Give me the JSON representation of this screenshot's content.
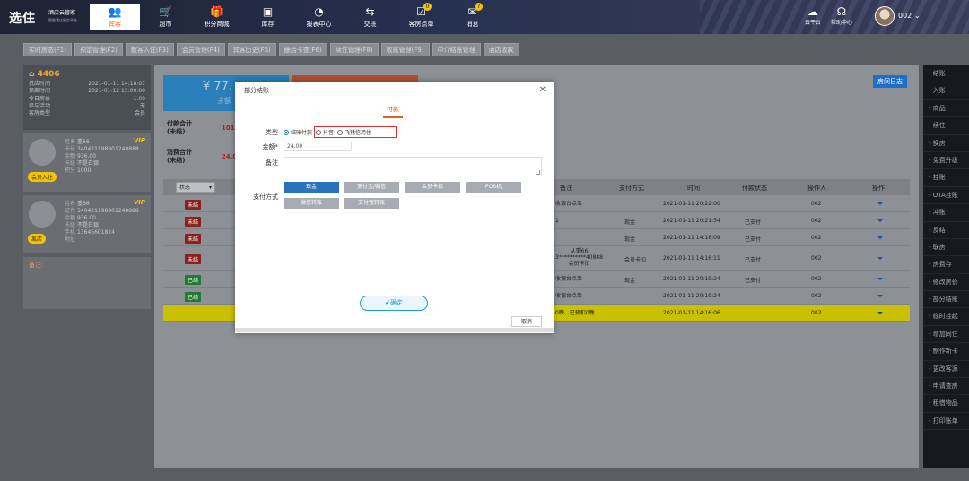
{
  "header": {
    "logo": "选住",
    "logo_sub": "酒店云管家",
    "logo_tagline": "智能酒店服务平台",
    "nav": [
      {
        "label": "宾客",
        "icon": "users-icon",
        "active": true
      },
      {
        "label": "超市",
        "icon": "cart-icon"
      },
      {
        "label": "积分商城",
        "icon": "gift-icon"
      },
      {
        "label": "库存",
        "icon": "box-icon"
      },
      {
        "label": "报表中心",
        "icon": "chart-icon"
      },
      {
        "label": "交班",
        "icon": "handover-icon"
      },
      {
        "label": "客房点单",
        "icon": "order-icon",
        "badge": "0"
      },
      {
        "label": "消息",
        "icon": "message-icon",
        "badge": "7"
      }
    ],
    "cloud_label": "云平台",
    "help_label": "帮助中心",
    "user": "002"
  },
  "tabs": [
    "实时房态(F1)",
    "预定管理(F2)",
    "散客入住(F3)",
    "会员管理(F4)",
    "宾客历史(F5)",
    "酬活卡查(F6)",
    "续住管理(F8)",
    "收账管理(F9)",
    "中介结账管理",
    "酒店收款"
  ],
  "room": {
    "number": "4406",
    "fields": [
      {
        "k": "抵店时间",
        "v": "2021-01-11 14:18:07"
      },
      {
        "k": "预离时间",
        "v": "2021-01-12 15:00:00"
      },
      {
        "k": "今日房价",
        "v": "1.00"
      },
      {
        "k": "参与活动",
        "v": "无"
      },
      {
        "k": "客房类型",
        "v": "会员"
      }
    ]
  },
  "guests": [
    {
      "tag": "会员入住",
      "vip": "VIP",
      "rows": [
        [
          "姓名",
          "重66"
        ],
        [
          "卡号",
          "340421198901240888"
        ],
        [
          "余额",
          "936.00"
        ],
        [
          "卡级",
          "不是白银"
        ],
        [
          "积分",
          "1000"
        ]
      ]
    },
    {
      "tag": "离店",
      "vip": "VIP",
      "rows": [
        [
          "姓名",
          "重66"
        ],
        [
          "证件",
          "340421198901240888"
        ],
        [
          "余额",
          "936.00"
        ],
        [
          "卡级",
          "不是白银"
        ],
        [
          "手机",
          "13645601824"
        ],
        [
          "地址",
          ""
        ]
      ]
    }
  ],
  "remark_label": "备注:",
  "main": {
    "pay_amount": "¥ 77.",
    "pay_sub": "余额",
    "log_button": "房间日志",
    "sum1_label": "付款合计\n(未结)",
    "sum1_val": "101",
    "sum2_label": "消费合计\n(未结)",
    "sum2_val": "24.0",
    "status_select": "状态",
    "headers": {
      "remark": "备注",
      "paymethod": "支付方式",
      "time": "时间",
      "paystatus": "付款状态",
      "operator": "操作人",
      "action": "操作"
    },
    "rows": [
      {
        "status": "未结",
        "color": "red",
        "remark": "收银台点单",
        "pay": "",
        "time": "2021-01-11 20:22:00",
        "paystatus": "",
        "op": "002"
      },
      {
        "status": "未结",
        "color": "red",
        "remark": "1",
        "pay": "现金",
        "time": "2021-01-11 20:21:54",
        "paystatus": "已支付",
        "op": "002"
      },
      {
        "status": "未结",
        "color": "red",
        "remark": "",
        "pay": "现金",
        "time": "2021-01-11 14:18:09",
        "paystatus": "已支付",
        "op": "002"
      },
      {
        "status": "未结",
        "color": "red",
        "remark": "从重66\n3**********40888\n会员卡扣",
        "pay": "会员卡扣",
        "time": "2021-01-11 14:16:11",
        "paystatus": "已支付",
        "op": "002"
      },
      {
        "status": "已结",
        "color": "green",
        "remark": "收银台点单",
        "pay": "现金",
        "time": "2021-01-11 20:19:24",
        "paystatus": "已支付",
        "op": "002"
      },
      {
        "status": "已结",
        "color": "green",
        "remark": "收银台点单",
        "pay": "",
        "time": "2021-01-11 20:19:24",
        "paystatus": "",
        "op": "002"
      },
      {
        "status": "",
        "color": "",
        "remark": "0晚、已预扣0晚",
        "pay": "",
        "time": "2021-01-11 14:16:06",
        "paystatus": "",
        "op": "002"
      }
    ]
  },
  "right_nav": [
    "结账",
    "入账",
    "商品",
    "续住",
    "换房",
    "免费升级",
    "挂账",
    "OTA挂账",
    "冲账",
    "反结",
    "联房",
    "房费存",
    "修改房价",
    "部分结账",
    "临时挂起",
    "增加同住",
    "制作新卡",
    "更改客源",
    "申请查房",
    "租借物品",
    "打印账单"
  ],
  "modal": {
    "title": "部分结账",
    "tab": "付款",
    "type_label": "类型",
    "types": [
      {
        "label": "结账付款",
        "on": true
      },
      {
        "label": "抖音",
        "on": false
      },
      {
        "label": "飞猪信用住",
        "on": false
      }
    ],
    "amount_label": "金额*",
    "amount_value": "24.00",
    "notes_label": "备注",
    "paymethod_label": "支付方式",
    "methods": [
      "现金",
      "支付宝/微信",
      "会员卡扣",
      "POS机",
      "微信转账",
      "支付宝转账"
    ],
    "confirm": "确定",
    "close_button": "取消"
  }
}
